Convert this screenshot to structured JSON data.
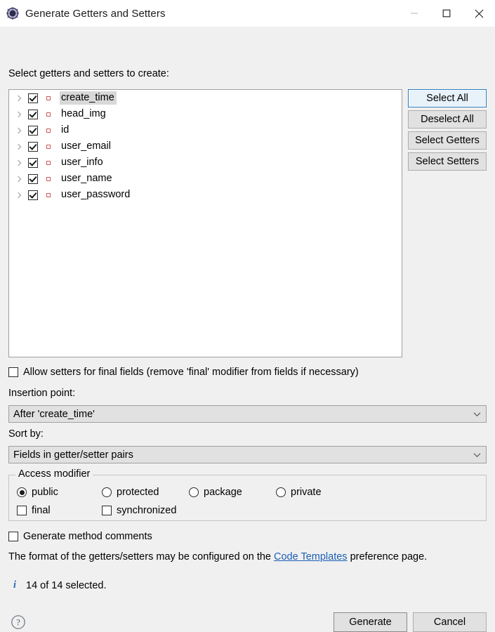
{
  "window": {
    "title": "Generate Getters and Setters",
    "icon": "eclipse-icon",
    "controls": {
      "minimize": "minimize-icon",
      "maximize": "maximize-icon",
      "close": "close-icon"
    }
  },
  "main": {
    "tree_label": "Select getters and setters to create:",
    "tree_items": [
      {
        "label": "create_time",
        "checked": true,
        "selected": true,
        "expanded": false,
        "icon": "field-icon"
      },
      {
        "label": "head_img",
        "checked": true,
        "selected": false,
        "expanded": false,
        "icon": "field-icon"
      },
      {
        "label": "id",
        "checked": true,
        "selected": false,
        "expanded": false,
        "icon": "field-icon"
      },
      {
        "label": "user_email",
        "checked": true,
        "selected": false,
        "expanded": false,
        "icon": "field-icon"
      },
      {
        "label": "user_info",
        "checked": true,
        "selected": false,
        "expanded": false,
        "icon": "field-icon"
      },
      {
        "label": "user_name",
        "checked": true,
        "selected": false,
        "expanded": false,
        "icon": "field-icon"
      },
      {
        "label": "user_password",
        "checked": true,
        "selected": false,
        "expanded": false,
        "icon": "field-icon"
      }
    ],
    "side_buttons": [
      {
        "label": "Select All",
        "focused": true
      },
      {
        "label": "Deselect All",
        "focused": false
      },
      {
        "label": "Select Getters",
        "focused": false
      },
      {
        "label": "Select Setters",
        "focused": false
      }
    ],
    "allow_setters": {
      "label": "Allow setters for final fields (remove 'final' modifier from fields if necessary)",
      "checked": false
    },
    "insertion_point": {
      "label": "Insertion point:",
      "value": "After 'create_time'"
    },
    "sort_by": {
      "label": "Sort by:",
      "value": "Fields in getter/setter pairs"
    },
    "access_modifier": {
      "title": "Access modifier",
      "selected": "public",
      "radios": [
        {
          "label": "public",
          "selected": true
        },
        {
          "label": "protected",
          "selected": false
        },
        {
          "label": "package",
          "selected": false
        },
        {
          "label": "private",
          "selected": false
        }
      ],
      "checkboxes": [
        {
          "label": "final",
          "checked": false
        },
        {
          "label": "synchronized",
          "checked": false
        }
      ]
    },
    "generate_comments": {
      "label": "Generate method comments",
      "checked": false
    },
    "format_note": {
      "prefix": "The format of the getters/setters may be configured on the ",
      "link": "Code Templates",
      "suffix": " preference page."
    },
    "status": {
      "icon": "info-icon",
      "text": "14 of 14 selected."
    }
  },
  "footer": {
    "help": "help-icon",
    "generate_label": "Generate",
    "cancel_label": "Cancel"
  },
  "colors": {
    "dialog_bg": "#f0f0f0",
    "list_bg": "#ffffff",
    "accent": "#2a7bbf",
    "link": "#1a5fb4",
    "field_icon": "#d05a5a",
    "info": "#2f6fb5"
  }
}
